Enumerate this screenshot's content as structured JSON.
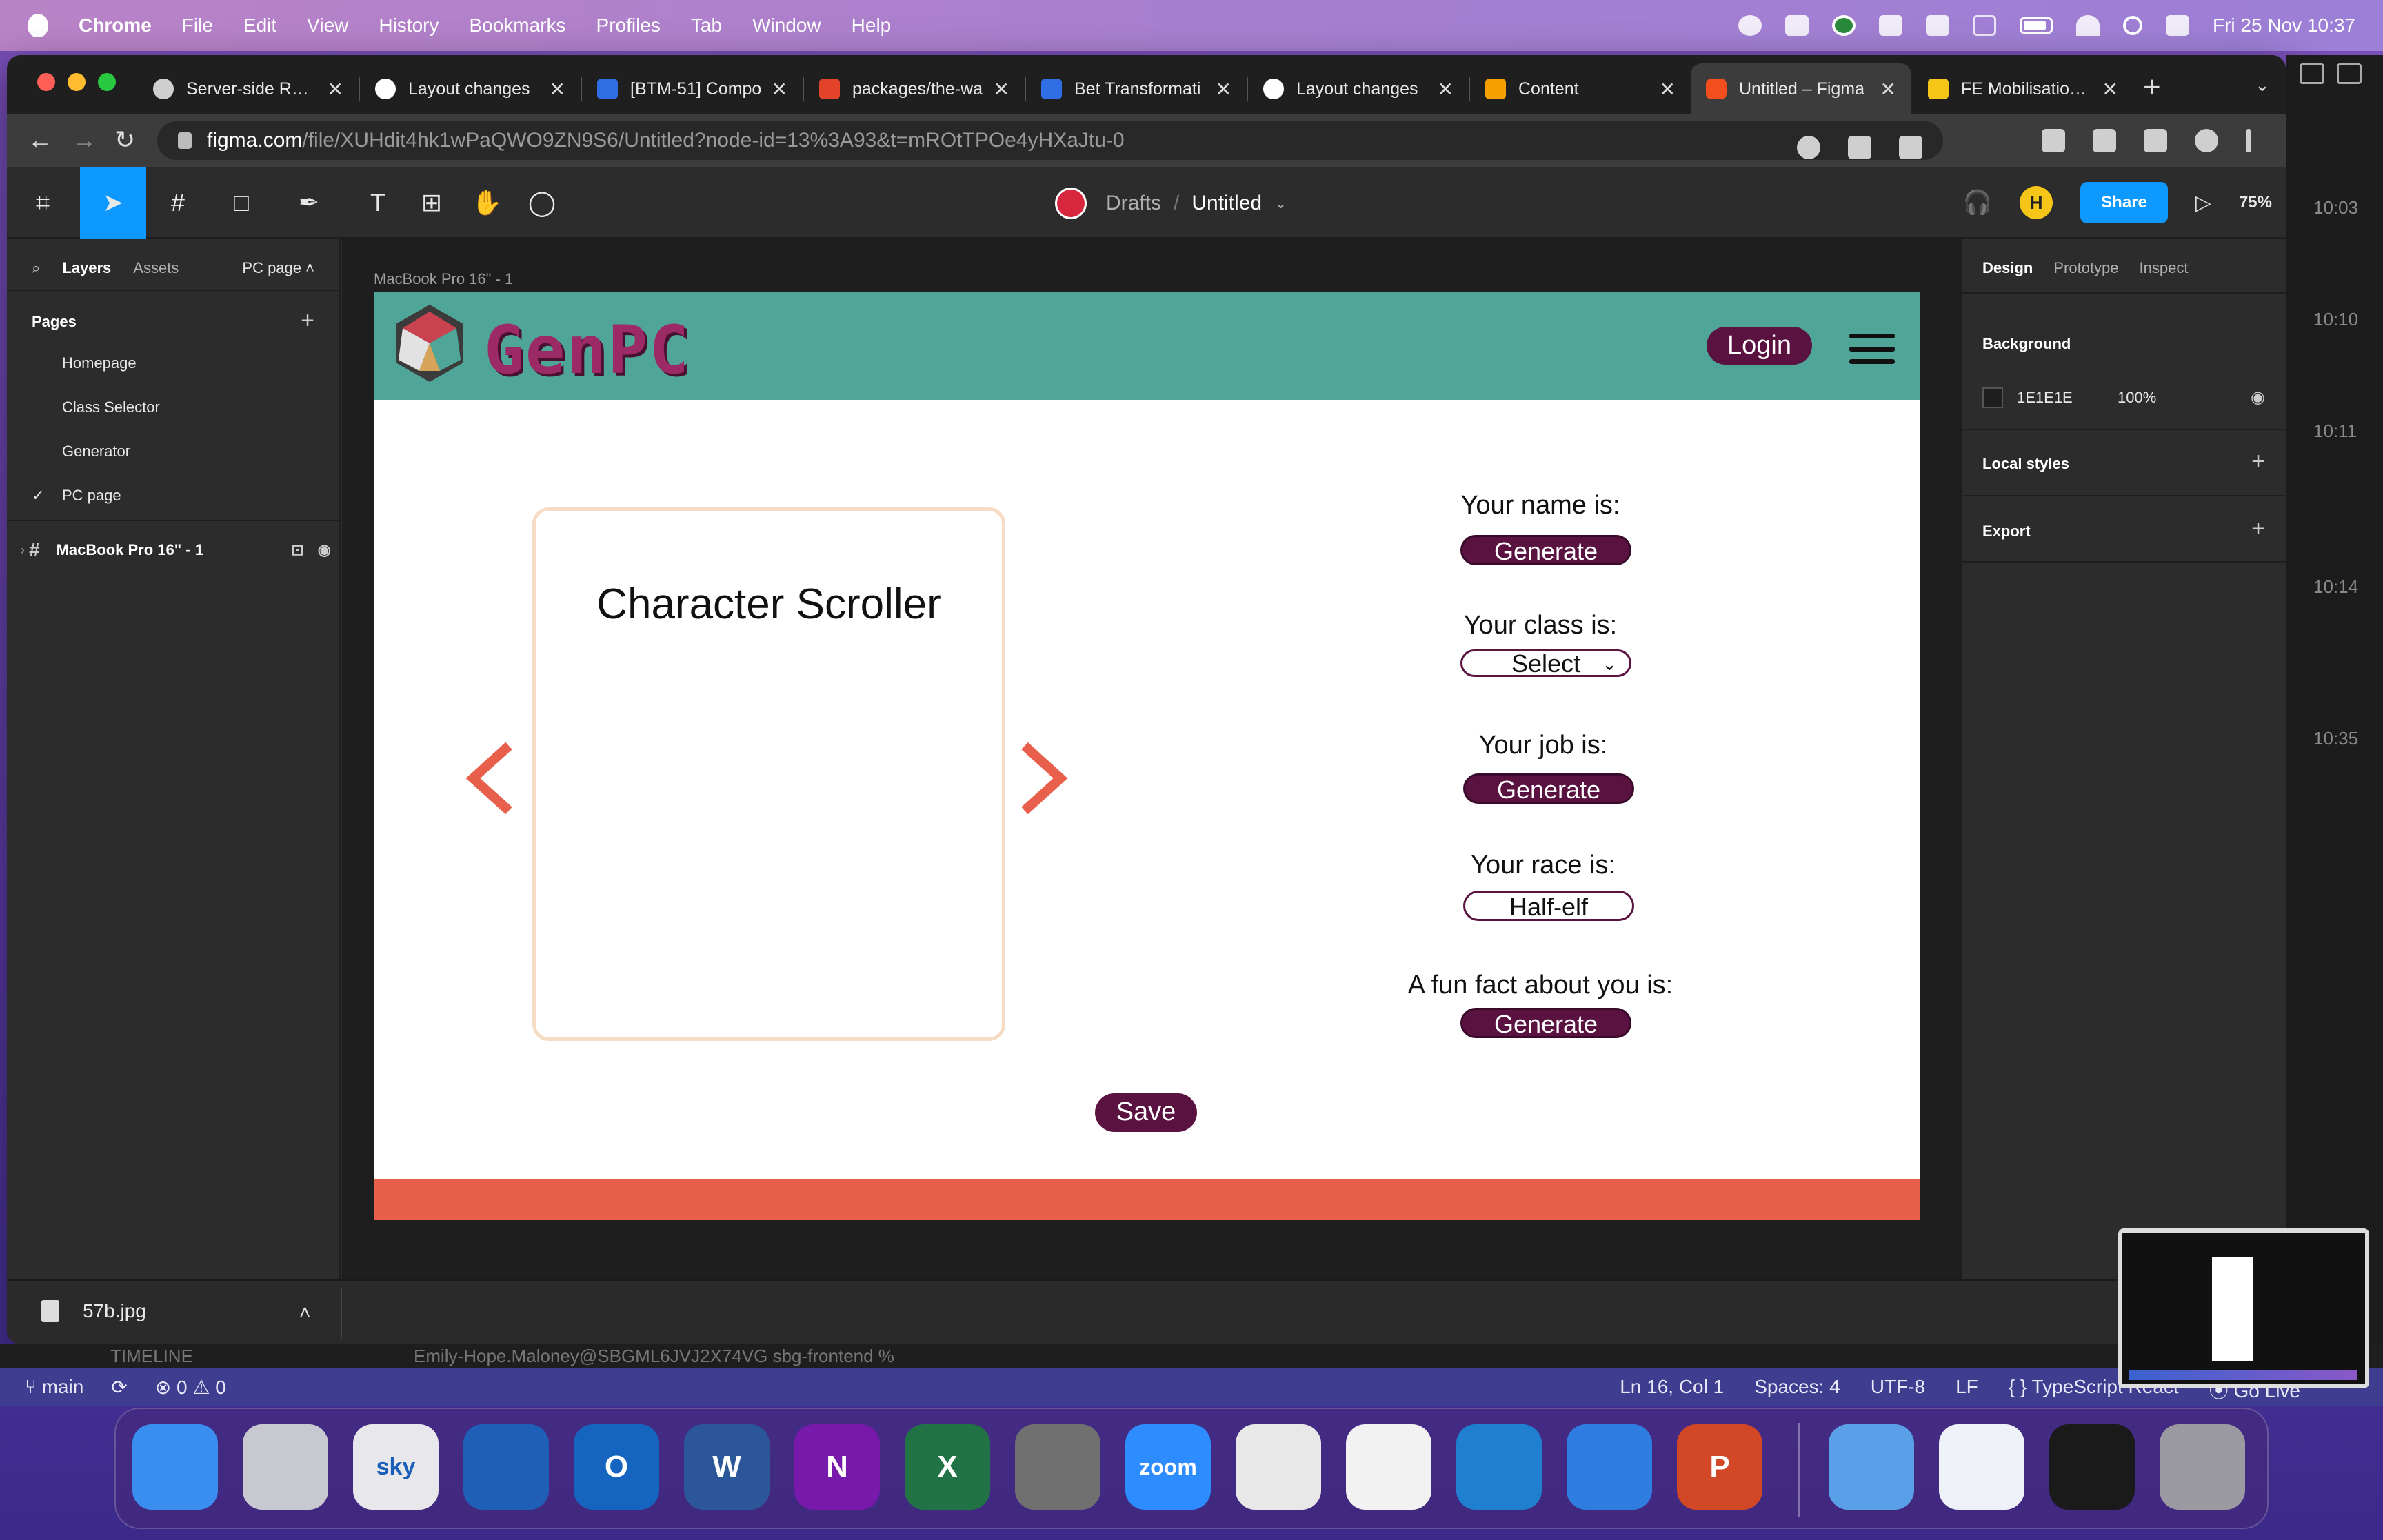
{
  "menubar": {
    "app": "Chrome",
    "items": [
      "File",
      "Edit",
      "View",
      "History",
      "Bookmarks",
      "Profiles",
      "Tab",
      "Window",
      "Help"
    ],
    "clock": "Fri 25 Nov  10:37"
  },
  "tabs": [
    {
      "label": "Server-side Rend",
      "color": "#cfcfcf"
    },
    {
      "label": "Layout changes",
      "color": "#ffffff"
    },
    {
      "label": "[BTM-51] Compo",
      "color": "#2f6ee5"
    },
    {
      "label": "packages/the-wa",
      "color": "#e24329"
    },
    {
      "label": "Bet Transformati",
      "color": "#2f6ee5"
    },
    {
      "label": "Layout changes",
      "color": "#ffffff"
    },
    {
      "label": "Content",
      "color": "#f59f00"
    },
    {
      "label": "Untitled – Figma",
      "color": "#f24e1e",
      "active": true
    },
    {
      "label": "FE Mobilisation F",
      "color": "#f5c518"
    }
  ],
  "omnibox": {
    "host": "figma.com",
    "path": "/file/XUHdit4hk1wPaQWO9ZN9S6/Untitled?node-id=13%3A93&t=mROtTPOe4yHXaJtu-0"
  },
  "figma": {
    "breadcrumb": {
      "team": "Drafts",
      "file": "Untitled"
    },
    "avatar": "H",
    "share": "Share",
    "zoom": "75%",
    "left": {
      "tab_layers": "Layers",
      "tab_assets": "Assets",
      "page_selector": "PC page",
      "pages_title": "Pages",
      "pages": [
        "Homepage",
        "Class Selector",
        "Generator",
        "PC page"
      ],
      "current_page": "PC page",
      "layer": "MacBook Pro 16\" - 1"
    },
    "frame_label": "MacBook Pro 16\" - 1",
    "right": {
      "tab_design": "Design",
      "tab_prototype": "Prototype",
      "tab_inspect": "Inspect",
      "background_title": "Background",
      "background_hex": "1E1E1E",
      "background_opacity": "100%",
      "local_styles": "Local styles",
      "export": "Export"
    },
    "help": "?"
  },
  "site": {
    "logo_text": "GenPC",
    "login": "Login",
    "scroller_title": "Character Scroller",
    "fields": [
      {
        "label": "Your name is:",
        "control": "Generate",
        "kind": "button"
      },
      {
        "label": "Your class is:",
        "control": "Select",
        "kind": "select"
      },
      {
        "label": "Your job is:",
        "control": "Generate",
        "kind": "button"
      },
      {
        "label": "Your race is:",
        "control": "Half-elf",
        "kind": "output"
      },
      {
        "label": "A fun fact about you is:",
        "control": "Generate",
        "kind": "button"
      }
    ],
    "save": "Save",
    "colors": {
      "header": "#4fa597",
      "footer": "#e8604c",
      "accent": "#5a1240",
      "arrow": "#e8604c"
    }
  },
  "download": {
    "filename": "57b.jpg"
  },
  "side_times": [
    "10:03",
    "10:10",
    "10:11",
    "10:14",
    "10:35"
  ],
  "vscode": {
    "branch": "main",
    "problems": "⊗ 0 ⚠ 0",
    "position": "Ln 16, Col 1",
    "spaces": "Spaces: 4",
    "encoding": "UTF-8",
    "eol": "LF",
    "language": "{ } TypeScript React",
    "golive": "Go Live",
    "ghost_left": "TIMELINE",
    "ghost_right": "Emily-Hope.Maloney@SBGML6JVJ2X74VG sbg-frontend %"
  },
  "dock": [
    {
      "name": "finder",
      "color": "#3a8ef0",
      "glyph": ""
    },
    {
      "name": "launchpad",
      "color": "#c8c8d0",
      "glyph": ""
    },
    {
      "name": "sky-betting",
      "color": "#e8e8ec",
      "glyph": "sky"
    },
    {
      "name": "security",
      "color": "#1f5fb8",
      "glyph": ""
    },
    {
      "name": "outlook",
      "color": "#1565c0",
      "glyph": "O"
    },
    {
      "name": "word",
      "color": "#2b579a",
      "glyph": "W"
    },
    {
      "name": "onenote",
      "color": "#7719aa",
      "glyph": "N"
    },
    {
      "name": "excel",
      "color": "#217346",
      "glyph": "X"
    },
    {
      "name": "system-preferences",
      "color": "#707070",
      "glyph": ""
    },
    {
      "name": "zoom",
      "color": "#2d8cff",
      "glyph": "zoom"
    },
    {
      "name": "chrome",
      "color": "#e8e8e8",
      "glyph": ""
    },
    {
      "name": "slack",
      "color": "#f2f2f2",
      "glyph": ""
    },
    {
      "name": "vscode",
      "color": "#1f80d0",
      "glyph": ""
    },
    {
      "name": "xcode",
      "color": "#2f7de1",
      "glyph": ""
    },
    {
      "name": "powerpoint",
      "color": "#d24726",
      "glyph": "P"
    }
  ]
}
